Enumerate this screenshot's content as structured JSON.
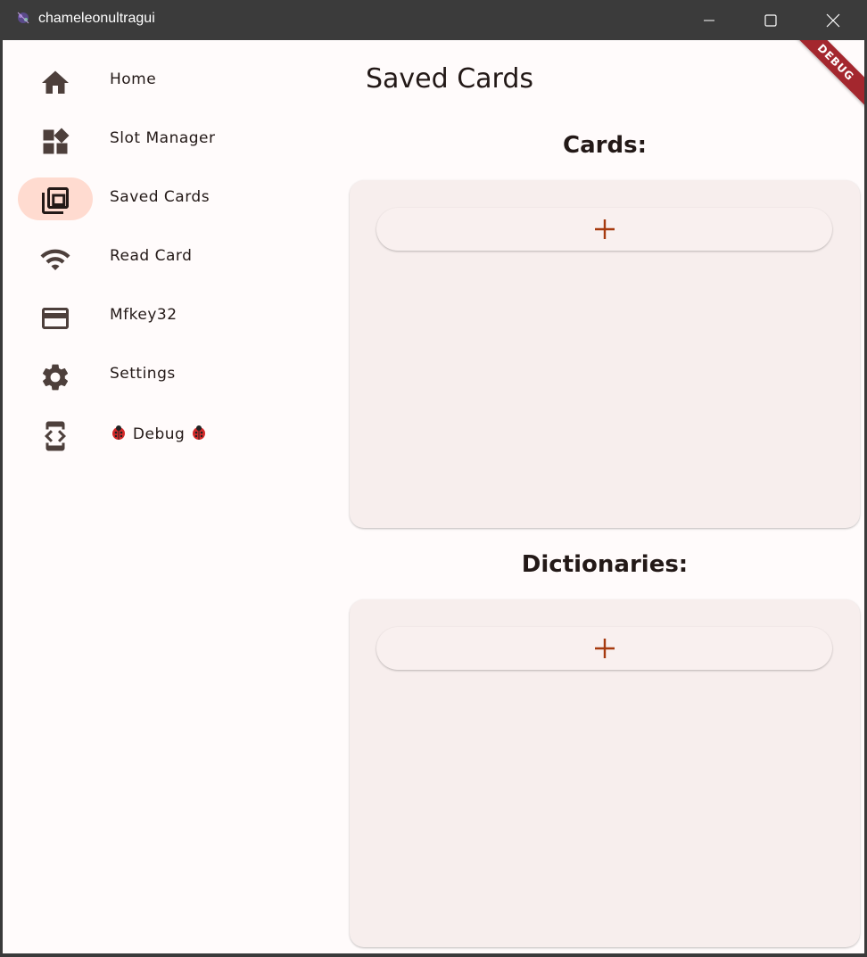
{
  "window": {
    "title": "chameleonultragui"
  },
  "nav": {
    "items": [
      {
        "label": "Home",
        "icon": "home-icon",
        "active": false
      },
      {
        "label": "Slot Manager",
        "icon": "dashboard-icon",
        "active": false
      },
      {
        "label": "Saved Cards",
        "icon": "library-icon",
        "active": true
      },
      {
        "label": "Read Card",
        "icon": "wifi-icon",
        "active": false
      },
      {
        "label": "Mfkey32",
        "icon": "credit-card-icon",
        "active": false
      },
      {
        "label": "Settings",
        "icon": "gear-icon",
        "active": false
      },
      {
        "label": "Debug",
        "icon": "developer-mode-icon",
        "active": false
      }
    ]
  },
  "main": {
    "title": "Saved Cards",
    "cards_section": {
      "title": "Cards:",
      "add_icon": "plus-icon"
    },
    "dictionaries_section": {
      "title": "Dictionaries:",
      "add_icon": "plus-icon"
    }
  },
  "banner": {
    "label": "DEBUG"
  },
  "colors": {
    "accent": "#a63a0f",
    "active_indicator": "#ffdbd0",
    "icon": "#4d3f3b",
    "panel": "#f7eeed",
    "banner": "#a4272e"
  }
}
